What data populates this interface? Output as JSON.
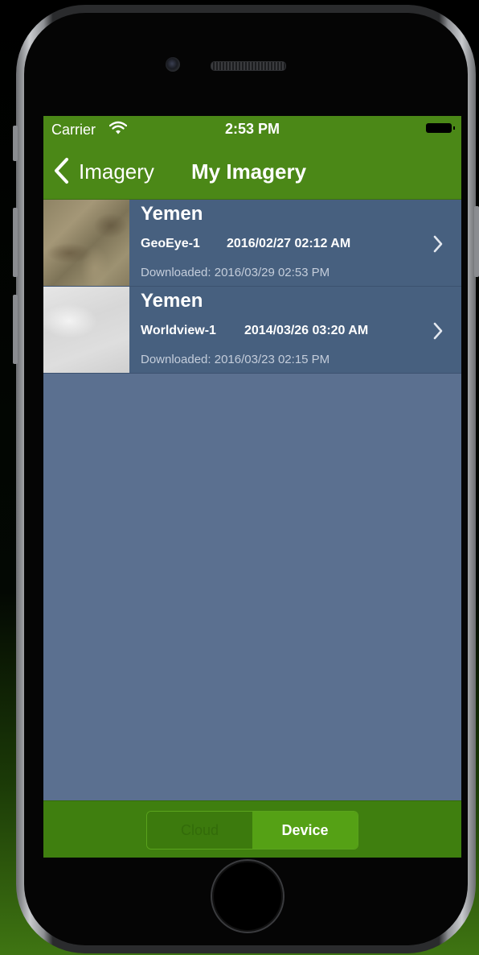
{
  "status_bar": {
    "carrier": "Carrier",
    "time": "2:53 PM"
  },
  "nav": {
    "back_label": "Imagery",
    "title": "My Imagery"
  },
  "imagery_list": [
    {
      "title": "Yemen",
      "sensor": "GeoEye-1",
      "captured": "2016/02/27 02:12 AM",
      "downloaded": "Downloaded: 2016/03/29 02:53 PM"
    },
    {
      "title": "Yemen",
      "sensor": "Worldview-1",
      "captured": "2014/03/26 03:20 AM",
      "downloaded": "Downloaded: 2016/03/23 02:15 PM"
    }
  ],
  "segmented_control": {
    "options": [
      "Cloud",
      "Device"
    ],
    "selected": "Device"
  },
  "colors": {
    "nav_green": "#4b8817",
    "list_background": "#5b7090",
    "row_background": "#47607f",
    "tab_bar_green": "#3f7f0f",
    "selected_segment": "#55a115"
  },
  "icons": [
    "wifi-icon",
    "battery-icon",
    "back-chevron-icon",
    "chevron-right-icon"
  ]
}
